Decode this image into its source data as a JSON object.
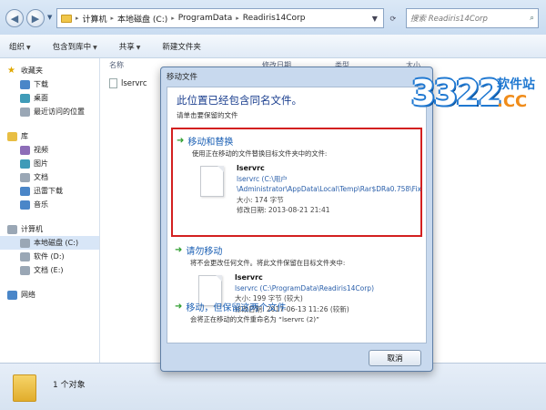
{
  "explorer": {
    "breadcrumbs": [
      "计算机",
      "本地磁盘 (C:)",
      "ProgramData",
      "Readiris14Corp"
    ],
    "search_placeholder": "搜索 Readiris14Corp",
    "toolbar": [
      "组织",
      "包含到库中",
      "共享",
      "新建文件夹"
    ],
    "sidebar": [
      {
        "label": "收藏夹",
        "group": true,
        "icon": "star-icon"
      },
      {
        "label": "下载",
        "icon": "download-folder-icon"
      },
      {
        "label": "桌面",
        "icon": "desktop-icon"
      },
      {
        "label": "最近访问的位置",
        "icon": "recent-places-icon"
      },
      {
        "label": "库",
        "group": true,
        "icon": "library-icon"
      },
      {
        "label": "视频",
        "icon": "video-icon"
      },
      {
        "label": "图片",
        "icon": "pictures-icon"
      },
      {
        "label": "文档",
        "icon": "documents-icon"
      },
      {
        "label": "迅雷下载",
        "icon": "thunder-download-icon"
      },
      {
        "label": "音乐",
        "icon": "music-icon"
      },
      {
        "label": "计算机",
        "group": true,
        "icon": "computer-icon"
      },
      {
        "label": "本地磁盘 (C:)",
        "icon": "drive-icon",
        "selected": true
      },
      {
        "label": "软件 (D:)",
        "icon": "drive-icon"
      },
      {
        "label": "文档 (E:)",
        "icon": "drive-icon"
      },
      {
        "label": "网络",
        "group": true,
        "icon": "network-icon"
      }
    ],
    "columns": [
      "名称",
      "修改日期",
      "类型",
      "大小"
    ],
    "file": "lservrc",
    "status": "1 个对象"
  },
  "dialog": {
    "title": "移动文件",
    "heading": "此位置已经包含同名文件。",
    "subheading": "请单击要保留的文件",
    "option1": {
      "title": "移动和替换",
      "desc": "使用正在移动的文件替换目标文件夹中的文件:",
      "name": "lservrc",
      "path1": "lservrc (C:\\用户",
      "path2": "\\Administrator\\AppData\\Local\\Temp\\Rar$DRa0.758\\Fix",
      "size": "大小: 174 字节",
      "date": "修改日期: 2013-08-21 21:41"
    },
    "option2": {
      "title": "请勿移动",
      "desc": "将不会更改任何文件。将此文件保留在目标文件夹中:",
      "name": "lservrc",
      "path": "lservrc (C:\\ProgramData\\Readiris14Corp)",
      "size": "大小: 199 字节 (较大)",
      "date": "修改日期: 2017-06-13 11:26 (较新)"
    },
    "option3": {
      "title": "移动，但保留这两个文件",
      "desc": "会将正在移动的文件重命名为 “lservrc (2)”"
    },
    "cancel": "取消"
  },
  "logo": {
    "number": "3322",
    "cn": "软件站",
    "cc": ".CC"
  }
}
